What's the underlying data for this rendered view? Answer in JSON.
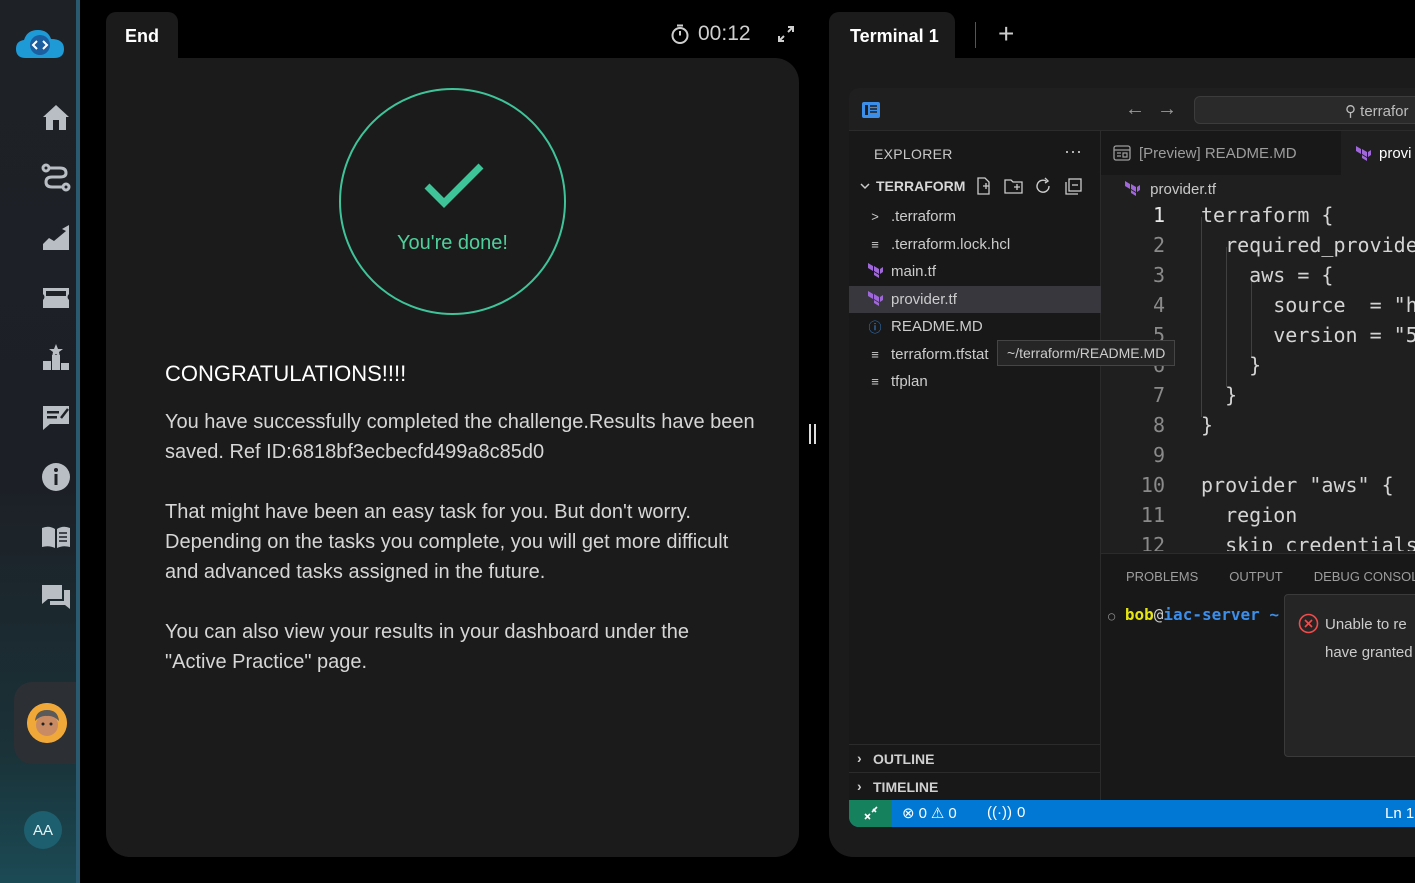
{
  "colors": {
    "accent_green": "#3fc49a",
    "statusbar_blue": "#0078d4",
    "remote_green": "#16825d",
    "sidebar_edge": "#2a5a70"
  },
  "sidebar": {
    "items": [
      {
        "name": "home-icon"
      },
      {
        "name": "route-icon"
      },
      {
        "name": "progress-icon"
      },
      {
        "name": "ticket-icon"
      },
      {
        "name": "leaderboard-icon"
      },
      {
        "name": "feedback-icon"
      },
      {
        "name": "info-icon"
      },
      {
        "name": "book-icon"
      },
      {
        "name": "chat-icon"
      }
    ],
    "user_initials": "AA"
  },
  "left_panel": {
    "tab_label": "End",
    "timer": "00:12",
    "done_label": "You're done!",
    "heading": "CONGRATULATIONS!!!!",
    "paragraphs": [
      "You have successfully completed the challenge.Results have been saved. Ref ID:6818bf3ecbecfd499a8c85d0",
      "That might have been an easy task for you. But don't worry. Depending on the tasks you complete, you will get more difficult and advanced tasks assigned in the future.",
      "You can also view your results in your dashboard under the \"Active Practice\" page."
    ]
  },
  "terminal": {
    "tab_label": "Terminal 1",
    "add_label": "+",
    "search_text": "terrafor",
    "explorer": {
      "title": "EXPLORER",
      "more": "···",
      "project": "TERRAFORM",
      "files": [
        {
          "icon": ">",
          "name": ".terraform",
          "selected": false
        },
        {
          "icon": "≡",
          "name": ".terraform.lock.hcl",
          "selected": false
        },
        {
          "icon": "tf",
          "name": "main.tf",
          "selected": false
        },
        {
          "icon": "tf",
          "name": "provider.tf",
          "selected": true
        },
        {
          "icon": "ⓘ",
          "name": "README.MD",
          "selected": false
        },
        {
          "icon": "≡",
          "name": "terraform.tfstat",
          "selected": false
        },
        {
          "icon": "≡",
          "name": "tfplan",
          "selected": false
        }
      ],
      "tooltip": "~/terraform/README.MD",
      "outline": "OUTLINE",
      "timeline": "TIMELINE"
    },
    "tabs": [
      {
        "label": "[Preview] README.MD"
      },
      {
        "label": "provi"
      }
    ],
    "breadcrumb": "provider.tf",
    "code_lines": [
      {
        "n": "1",
        "text": "terraform {"
      },
      {
        "n": "2",
        "text": "  required_provide"
      },
      {
        "n": "3",
        "text": "    aws = {"
      },
      {
        "n": "4",
        "text": "      source  = \"h"
      },
      {
        "n": "5",
        "text": "      version = \"5"
      },
      {
        "n": "6",
        "text": "    }"
      },
      {
        "n": "7",
        "text": "  }"
      },
      {
        "n": "8",
        "text": "}"
      },
      {
        "n": "9",
        "text": ""
      },
      {
        "n": "10",
        "text": "provider \"aws\" {"
      },
      {
        "n": "11",
        "text": "  region"
      },
      {
        "n": "12",
        "text": "  skip_credentials"
      }
    ],
    "panel_tabs": [
      "PROBLEMS",
      "OUTPUT",
      "DEBUG CONSOLE"
    ],
    "prompt_user": "bob",
    "prompt_at": "@",
    "prompt_host": "iac-server",
    "prompt_tail": " ~",
    "notification": [
      "Unable to re",
      "have granted"
    ],
    "status": {
      "errors": "0",
      "warnings": "0",
      "ports": "0",
      "position": "Ln 1,"
    }
  }
}
